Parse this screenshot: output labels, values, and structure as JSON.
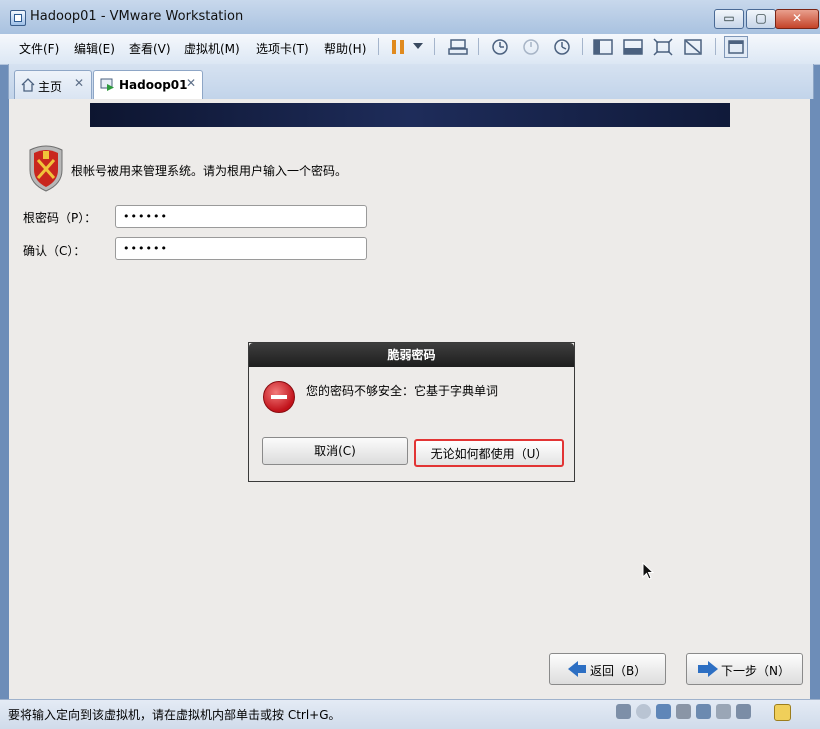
{
  "window": {
    "title": "Hadoop01 - VMware Workstation",
    "minimize_glyph": "▭",
    "maximize_glyph": "▢",
    "close_glyph": "✕"
  },
  "menu": [
    "文件(F)",
    "编辑(E)",
    "查看(V)",
    "虚拟机(M)",
    "选项卡(T)",
    "帮助(H)"
  ],
  "toolbar_icons": [
    "pause-icon",
    "dropdown-icon",
    "send-ctrl-alt-del-icon",
    "snapshot-take-icon",
    "snapshot-revert-icon",
    "snapshot-manager-icon",
    "sidebar-view-icon",
    "console-view-icon",
    "fullscreen-icon",
    "unity-icon",
    "thumbnail-view-icon"
  ],
  "tabs": [
    {
      "label": "主页",
      "close": "✕"
    },
    {
      "label": "Hadoop01",
      "close": "✕"
    }
  ],
  "installer": {
    "intro": "根帐号被用来管理系统。请为根用户输入一个密码。",
    "root_password_label": "根密码（P）：",
    "root_password_value": "••••••",
    "confirm_label": "确认（C）：",
    "confirm_value": "••••••",
    "back_label": "返回（B）",
    "next_label": "下一步（N）"
  },
  "dialog": {
    "title": "脆弱密码",
    "message": "您的密码不够安全：它基于字典单词",
    "cancel_label": "取消(C)",
    "use_anyway_label": "无论如何都使用（U）"
  },
  "status": {
    "text": "要将输入定向到该虚拟机，请在虚拟机内部单击或按 Ctrl+G。",
    "icons": [
      "hdd-icon",
      "cdrom-icon",
      "network-icon",
      "usb-icon",
      "sound-icon",
      "printer-icon",
      "display-icon",
      "message-icon"
    ]
  },
  "colors": {
    "error_red": "#c1121a",
    "highlight_red": "#e23434",
    "arrow_blue": "#2d6fc3",
    "banner_navy": "#1e2c5a"
  }
}
